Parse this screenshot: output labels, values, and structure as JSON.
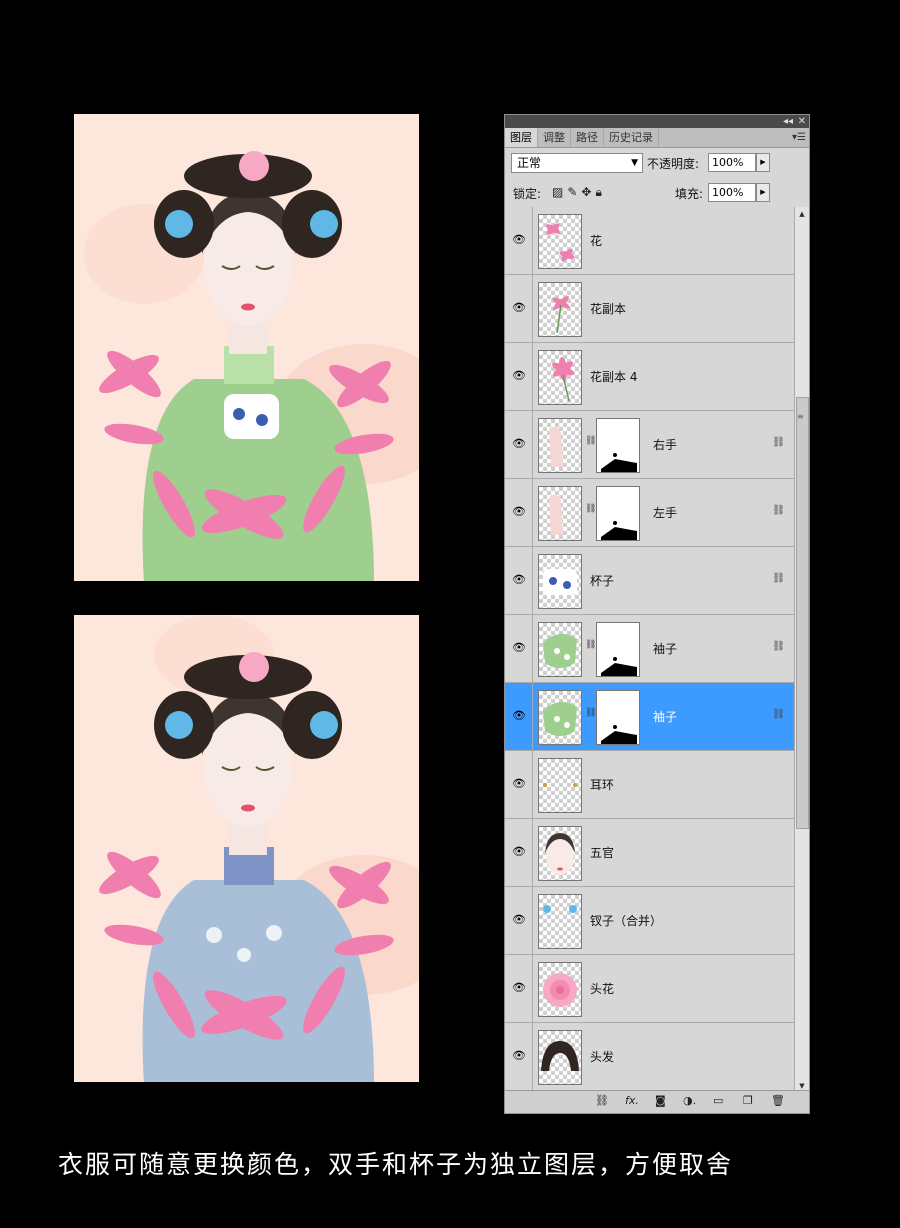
{
  "panel": {
    "tabs": [
      {
        "label": "图层",
        "active": true
      },
      {
        "label": "调整",
        "active": false
      },
      {
        "label": "路径",
        "active": false
      },
      {
        "label": "历史记录",
        "active": false
      }
    ],
    "blend_mode": "正常",
    "opacity_label": "不透明度:",
    "opacity_value": "100%",
    "lock_label": "锁定:",
    "fill_label": "填充:",
    "fill_value": "100%",
    "layers": [
      {
        "name": "花",
        "has_mask": false,
        "linked": false,
        "selected": false,
        "thumb": "flower"
      },
      {
        "name": "花副本",
        "has_mask": false,
        "linked": false,
        "selected": false,
        "thumb": "flower2"
      },
      {
        "name": "花副本 4",
        "has_mask": false,
        "linked": false,
        "selected": false,
        "thumb": "flower3"
      },
      {
        "name": "右手",
        "has_mask": true,
        "linked": true,
        "selected": false,
        "thumb": "hand"
      },
      {
        "name": "左手",
        "has_mask": true,
        "linked": true,
        "selected": false,
        "thumb": "hand"
      },
      {
        "name": "杯子",
        "has_mask": false,
        "linked": true,
        "selected": false,
        "thumb": "cup"
      },
      {
        "name": "袖子",
        "has_mask": true,
        "linked": true,
        "selected": false,
        "thumb": "sleeve"
      },
      {
        "name": "袖子",
        "has_mask": true,
        "linked": true,
        "selected": true,
        "thumb": "sleeve"
      },
      {
        "name": "耳环",
        "has_mask": false,
        "linked": false,
        "selected": false,
        "thumb": "earring"
      },
      {
        "name": "五官",
        "has_mask": false,
        "linked": false,
        "selected": false,
        "thumb": "face"
      },
      {
        "name": "钗子（合并）",
        "has_mask": false,
        "linked": false,
        "selected": false,
        "thumb": "hairpin"
      },
      {
        "name": "头花",
        "has_mask": false,
        "linked": false,
        "selected": false,
        "thumb": "rose"
      },
      {
        "name": "头发",
        "has_mask": false,
        "linked": false,
        "selected": false,
        "thumb": "hair"
      }
    ]
  },
  "art": {
    "top_robe_color": "#9fcf8f",
    "bottom_robe_color": "#a9bfd8",
    "background_color": "#fde6dc",
    "flower_color": "#f07fb0"
  },
  "caption": "衣服可随意更换颜色，双手和杯子为独立图层，方便取舍"
}
